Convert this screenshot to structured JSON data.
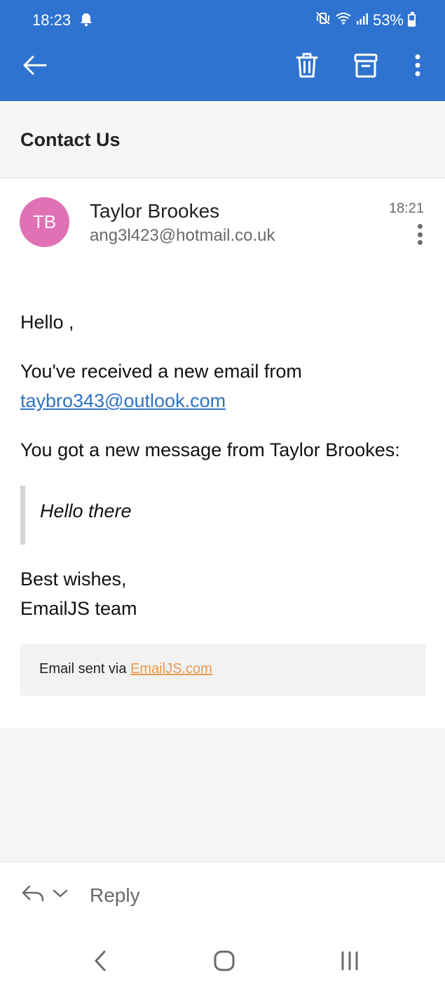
{
  "status_bar": {
    "time": "18:23",
    "battery": "53%",
    "icons": [
      "notification-bell-icon",
      "vibrate-mute-icon",
      "wifi-icon",
      "signal-icon",
      "battery-icon"
    ]
  },
  "app_bar": {
    "actions": [
      "back-arrow-icon",
      "delete-trash-icon",
      "archive-icon",
      "more-vertical-icon"
    ]
  },
  "email": {
    "subject": "Contact Us",
    "sender": {
      "initials": "TB",
      "name": "Taylor Brookes",
      "email": "ang3l423@hotmail.co.uk",
      "avatar_color": "#e071b5"
    },
    "time": "18:21",
    "body": {
      "greeting": "Hello ,",
      "received_prefix": "You've received a new email from",
      "received_link": "taybro343@outlook.com",
      "new_message_line": "You got a new message from Taylor Brookes:",
      "quote": "Hello there",
      "signoff_1": "Best wishes,",
      "signoff_2": "EmailJS team"
    },
    "footer": {
      "prefix": "Email sent via",
      "link": "EmailJS.com"
    }
  },
  "reply_bar": {
    "label": "Reply"
  },
  "colors": {
    "app_bar": "#2f73d0",
    "link": "#2f73c4",
    "footer_link": "#e89a4b"
  }
}
